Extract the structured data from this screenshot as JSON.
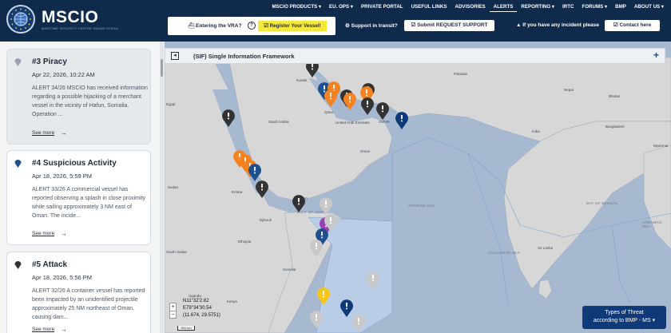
{
  "brand": {
    "name": "MSCIO",
    "subtitle": "MARITIME SECURITY CENTRE INDIAN OCEAN"
  },
  "topnav": [
    {
      "label": "MSCIO PRODUCTS ▾",
      "active": false
    },
    {
      "label": "EU. OPS ▾",
      "active": false
    },
    {
      "label": "PRIVATE PORTAL",
      "active": false
    },
    {
      "label": "USEFUL LINKS",
      "active": false
    },
    {
      "label": "ADVISORIES",
      "active": false
    },
    {
      "label": "ALERTS",
      "active": true
    },
    {
      "label": "REPORTING ▾",
      "active": false
    },
    {
      "label": "IRTC",
      "active": false
    },
    {
      "label": "FORUMS ▾",
      "active": false
    },
    {
      "label": "BMP",
      "active": false
    },
    {
      "label": "ABOUT US ▾",
      "active": false
    }
  ],
  "vra": {
    "label": "Entering the VRA?",
    "help": "?",
    "register_label": "☑ Register Your Vessel!"
  },
  "support": {
    "label": "⚙ Support in transit?",
    "button": "☑ Submit REQUEST SUPPORT"
  },
  "incident": {
    "label": "▲ If you have any incident please",
    "button": "☑ Contact here"
  },
  "alerts": [
    {
      "title": "#3 Piracy",
      "date": "Apr 22, 2026, 10:22 AM",
      "body": "ALERT 34/26 MSCIO has received information regarding a possible hijacking of a merchant vessel in the vicinity of Hafun, Somalia. Operation ...",
      "more": "See more",
      "color": "#9aa3ad"
    },
    {
      "title": "#4 Suspicious Activity",
      "date": "Apr 18, 2026, 5:59 PM",
      "body": "ALERT 33/26 A commercial vessel has reported observing a splash in close proximity while sailing approximately 3 NM east of Oman. The incide...",
      "more": "See more",
      "color": "#1f4f8f"
    },
    {
      "title": "#5 Attack",
      "date": "Apr 18, 2026, 5:56 PM",
      "body": "ALERT 32/26 A container vessel has reported been impacted by an unidentified projectile approximately 25 NM northeast of Oman, causing dam...",
      "more": "See more",
      "color": "#333333"
    }
  ],
  "panel": {
    "title": "(SIF) Single Information Framework",
    "collapse": "◂",
    "plus": "+"
  },
  "map_labels": {
    "kuwait": "Kuwait",
    "pakistan": "Pakistan",
    "egypt": "Egypt",
    "nepal": "Nepal",
    "bhutan": "Bhutan",
    "saudi": "Saudi Arabia",
    "uae": "United Arab Emirates",
    "qatar": "Qatar",
    "oman": "OMAN",
    "india": "India",
    "bangladesh": "Bangladesh",
    "myanmar": "Myanmar",
    "oman2": "Oman",
    "sudan": "Sudan",
    "eritrea": "Eritrea",
    "yemen": "Yemen",
    "djibouti": "Djibouti",
    "gulf_aden": "GULF OF ADEN",
    "arabian_sea": "ARABIAN SEA",
    "bay_bengal": "BAY OF BENGAL",
    "andaman": "ANDAMAN SEA",
    "ethiopia": "Ethiopia",
    "south_sudan": "South Sudan",
    "somalia": "Somalia",
    "laccadive": "LACCADIVE SEA",
    "sri_lanka": "Sri Lanka",
    "kenya": "Kenya",
    "uganda": "Uganda"
  },
  "zoom": {
    "in": "+",
    "out": "−"
  },
  "coords": {
    "lat": "N11°32'2.82",
    "lon": "E79°34'30.54",
    "dec": "(11.674, 29.5751)"
  },
  "scale": "500 km",
  "legend": {
    "line1": "Types of Threat",
    "line2": "according to BMP - MS ▾"
  },
  "colors": {
    "header": "#0f2a4a",
    "sea": "#a7b9d0",
    "land": "#d6d6d6",
    "accent": "#f5e83a"
  }
}
